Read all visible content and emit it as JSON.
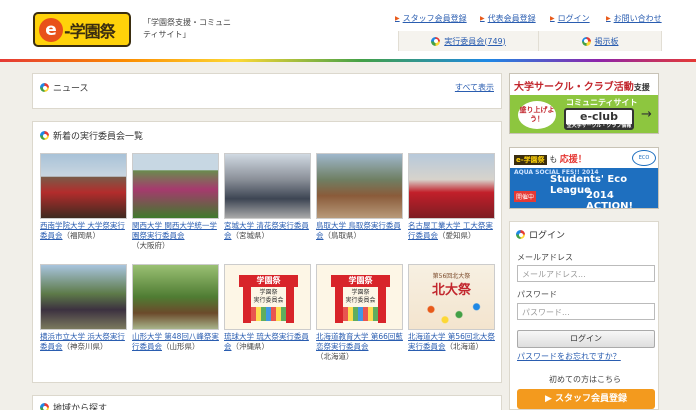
{
  "header": {
    "logo_mark": "e",
    "logo_text": "-学園祭",
    "tagline": "「学園祭支援・コミュニティサイト」",
    "nav": [
      {
        "label": "スタッフ会員登録"
      },
      {
        "label": "代表会員登録"
      },
      {
        "label": "ログイン"
      },
      {
        "label": "お問い合わせ"
      }
    ],
    "subnav": [
      {
        "label": "実行委員会(749)"
      },
      {
        "label": "掲示板"
      }
    ]
  },
  "news": {
    "title": "ニュース",
    "more": "すべて表示"
  },
  "committees": {
    "title": "新着の実行委員会一覧",
    "items": [
      {
        "link": "西南学院大学 大学祭実行委員会",
        "area": "（福岡県）"
      },
      {
        "link": "関西大学 関西大学統一学園祭実行委員会",
        "area": "（大阪府）"
      },
      {
        "link": "宮城大学 清花祭実行委員会",
        "area": "（宮城県）"
      },
      {
        "link": "鳥取大学 鳥取祭実行委員会",
        "area": "（鳥取県）"
      },
      {
        "link": "名古屋工業大学 工大祭実行委員会",
        "area": "（愛知県）"
      },
      {
        "link": "横浜市立大学 浜大祭実行委員会",
        "area": "（神奈川県）"
      },
      {
        "link": "山形大学 第48回八峰祭実行委員会",
        "area": "（山形県）"
      },
      {
        "link": "琉球大学 琉大祭実行委員会",
        "area": "（沖縄県）"
      },
      {
        "link": "北海道教育大学 第66回藍恋祭実行委員会",
        "area": "（北海道）"
      },
      {
        "link": "北海道大学 第56回北大祭実行委員会",
        "area": "（北海道）"
      }
    ],
    "gate_title": "学園祭",
    "gate_sub": "学園祭\n実行委員会",
    "hokudai_sub": "第56回北大祭",
    "hokudai_title": "北大祭"
  },
  "region": {
    "title": "地域から探す"
  },
  "banner_club": {
    "title": "大学サークル・クラブ活動",
    "title_suffix": "支援",
    "sub": "コミュニティサイト",
    "badge": "盛り上げよう！",
    "logo": "e-club",
    "logo_sub": "全大学サークル・クラブ情報",
    "arrow": "→"
  },
  "banner_eco": {
    "tag": "e-学園祭",
    "mo": "も",
    "cheer": "応援！",
    "eco_badge": "ECO",
    "line1": "AQUA SOCIAL FES!! 2014",
    "line2": "Students' Eco League",
    "status": "開催中",
    "line3": "2014 ACTION!"
  },
  "login": {
    "title": "ログイン",
    "email_label": "メールアドレス",
    "email_placeholder": "メールアドレス...",
    "password_label": "パスワード",
    "password_placeholder": "パスワード...",
    "button": "ログイン",
    "forgot": "パスワードをお忘れですか？",
    "first_time": "初めての方はこちら",
    "register": "スタッフ会員登録"
  },
  "colors": {
    "accent_orange": "#f39a1e",
    "link_blue": "#2a5db0",
    "logo_yellow": "#ffd20a",
    "eclub_green": "#8dc63f"
  }
}
